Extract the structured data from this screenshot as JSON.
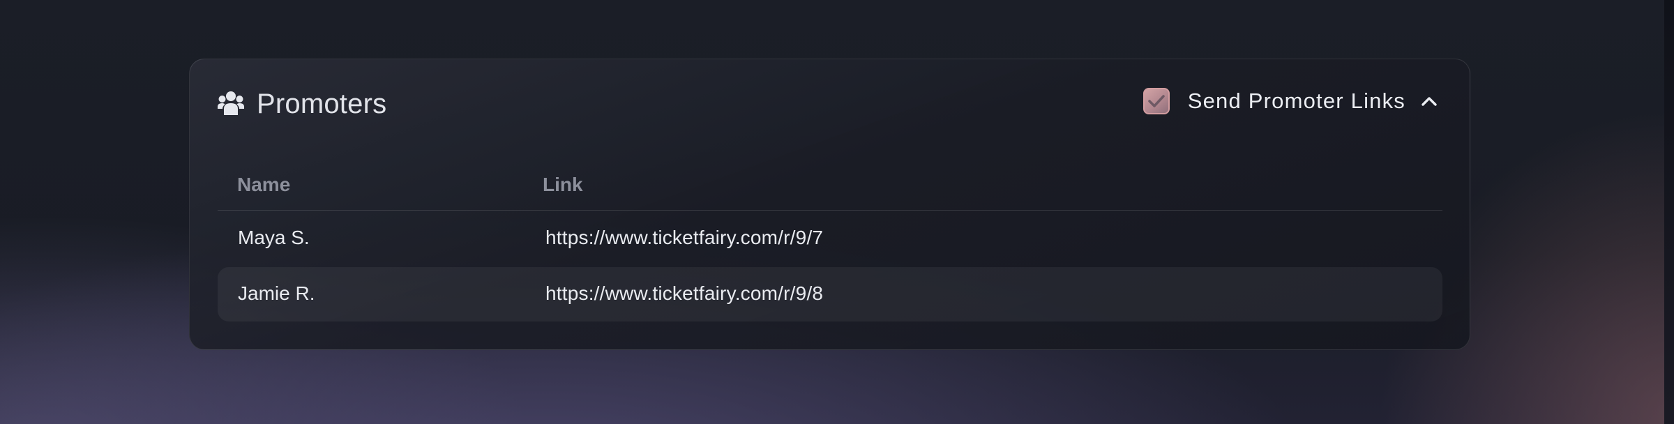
{
  "colors": {
    "accent_checkbox": "#c4979a",
    "title_text": "#e2e4ea",
    "header_text": "#8d909c",
    "cell_text": "#e9ebf0"
  },
  "panel": {
    "icon": "users-icon",
    "title": "Promoters",
    "send_links": {
      "label": "Send Promoter Links",
      "checked": true,
      "expanded": true,
      "chevron_icon": "chevron-up-icon"
    }
  },
  "table": {
    "columns": [
      "Name",
      "Link"
    ],
    "rows": [
      {
        "name": "Maya S.",
        "link": "https://www.ticketfairy.com/r/9/7"
      },
      {
        "name": "Jamie R.",
        "link": "https://www.ticketfairy.com/r/9/8"
      }
    ]
  }
}
